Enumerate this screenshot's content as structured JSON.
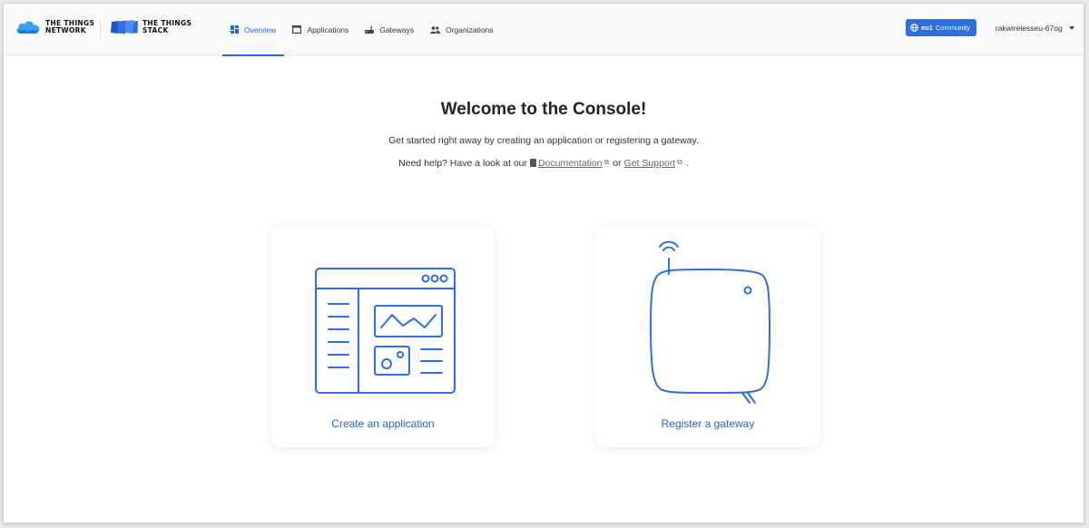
{
  "brand": {
    "ttn_line1": "THE THINGS",
    "ttn_line2": "NETWORK",
    "tts_line1": "THE THINGS",
    "tts_line2": "STACK"
  },
  "nav": {
    "overview": "Overview",
    "applications": "Applications",
    "gateways": "Gateways",
    "organizations": "Organizations"
  },
  "region": {
    "cluster": "eu1",
    "label": "Community"
  },
  "user": {
    "name": "rakwirelesseu-67og"
  },
  "main": {
    "title": "Welcome to the Console!",
    "subtitle": "Get started right away by creating an application or registering a gateway.",
    "help_prefix": "Need help? Have a look at our",
    "documentation": "Documentation",
    "or": "or",
    "get_support": "Get Support",
    "help_suffix": "."
  },
  "cards": {
    "create_application": "Create an application",
    "register_gateway": "Register a gateway"
  },
  "colors": {
    "accent": "#2567d7",
    "badge": "#2b6fe0"
  }
}
